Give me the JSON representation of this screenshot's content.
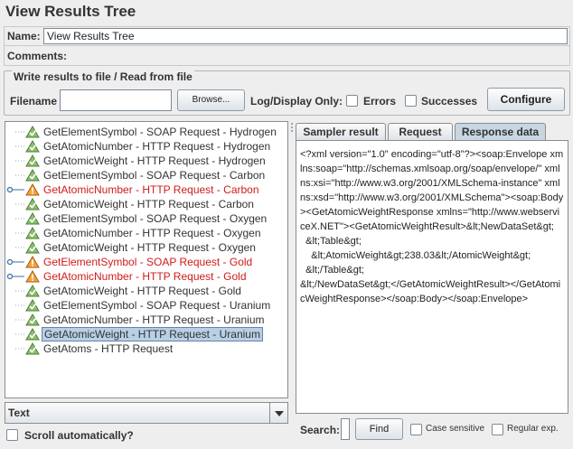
{
  "window_title": "View Results Tree",
  "name_field": {
    "label": "Name:",
    "value": "View Results Tree"
  },
  "comments": {
    "label": "Comments:"
  },
  "file_panel": {
    "legend": "Write results to file / Read from file",
    "filename_label": "Filename",
    "filename_value": "",
    "browse_label": "Browse...",
    "log_display_label": "Log/Display Only:",
    "errors_label": "Errors",
    "successes_label": "Successes",
    "configure_label": "Configure"
  },
  "tree": {
    "items": [
      {
        "label": "GetElementSymbol - SOAP Request - Hydrogen",
        "status": "success"
      },
      {
        "label": "GetAtomicNumber - HTTP Request - Hydrogen",
        "status": "success"
      },
      {
        "label": "GetAtomicWeight - HTTP Request - Hydrogen",
        "status": "success"
      },
      {
        "label": "GetElementSymbol - SOAP Request - Carbon",
        "status": "success"
      },
      {
        "label": "GetAtomicNumber - HTTP Request - Carbon",
        "status": "failed"
      },
      {
        "label": "GetAtomicWeight - HTTP Request - Carbon",
        "status": "success"
      },
      {
        "label": "GetElementSymbol - SOAP Request - Oxygen",
        "status": "success"
      },
      {
        "label": "GetAtomicNumber - HTTP Request - Oxygen",
        "status": "success"
      },
      {
        "label": "GetAtomicWeight - HTTP Request - Oxygen",
        "status": "success"
      },
      {
        "label": "GetElementSymbol - SOAP Request - Gold",
        "status": "failed"
      },
      {
        "label": "GetAtomicNumber - HTTP Request - Gold",
        "status": "failed"
      },
      {
        "label": "GetAtomicWeight - HTTP Request - Gold",
        "status": "success"
      },
      {
        "label": "GetElementSymbol - SOAP Request - Uranium",
        "status": "success"
      },
      {
        "label": "GetAtomicNumber - HTTP Request - Uranium",
        "status": "success"
      },
      {
        "label": "GetAtomicWeight - HTTP Request - Uranium",
        "status": "success",
        "selected": true
      },
      {
        "label": "GetAtoms - HTTP Request",
        "status": "success"
      }
    ]
  },
  "renderer_select": {
    "value": "Text"
  },
  "scroll_auto": {
    "label": "Scroll automatically?"
  },
  "tabs": [
    {
      "label": "Sampler result",
      "active": false
    },
    {
      "label": "Request",
      "active": false
    },
    {
      "label": "Response data",
      "active": true
    }
  ],
  "response_text": "<?xml version=\"1.0\" encoding=\"utf-8\"?><soap:Envelope xmlns:soap=\"http://schemas.xmlsoap.org/soap/envelope/\" xmlns:xsi=\"http://www.w3.org/2001/XMLSchema-instance\" xmlns:xsd=\"http://www.w3.org/2001/XMLSchema\"><soap:Body><GetAtomicWeightResponse xmlns=\"http://www.webserviceX.NET\"><GetAtomicWeightResult>&lt;NewDataSet&gt;\n  &lt;Table&gt;\n    &lt;AtomicWeight&gt;238.03&lt;/AtomicWeight&gt;\n  &lt;/Table&gt;\n&lt;/NewDataSet&gt;</GetAtomicWeightResult></GetAtomicWeightResponse></soap:Body></soap:Envelope>",
  "search": {
    "label": "Search:",
    "value": "",
    "find_label": "Find",
    "case_sensitive_label": "Case sensitive",
    "regex_label": "Regular exp."
  }
}
